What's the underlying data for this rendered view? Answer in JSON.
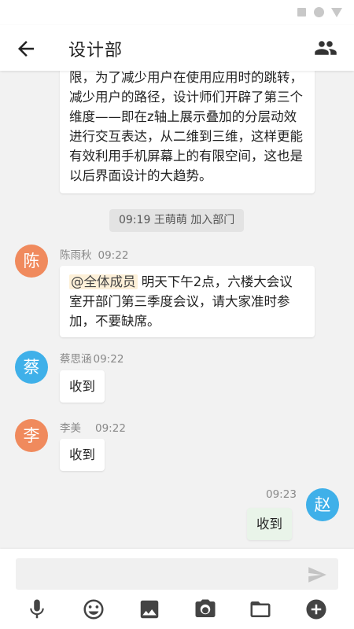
{
  "header": {
    "title": "设计部",
    "back_icon": "arrow-back-icon",
    "group_icon": "group-members-icon"
  },
  "messages": {
    "first": {
      "text": "限，为了减少用户在使用应用时的跳转，减少用户的路径，设计师们开辟了第三个维度——即在z轴上展示叠加的分层动效进行交互表达，从二维到三维，这样更能有效利用手机屏幕上的有限空间，这也是以后界面设计的大趋势。"
    },
    "system": {
      "text": "09:19 王萌萌 加入部门"
    },
    "chen": {
      "avatar": "陈",
      "avatar_color": "#f08a5d",
      "name": "陈雨秋",
      "time": "09:22",
      "mention": "@全体成员",
      "text": " 明天下午2点，六楼大会议室开部门第三季度会议，请大家准时参加，不要缺席。"
    },
    "cai": {
      "avatar": "蔡",
      "avatar_color": "#3fb0e9",
      "name": "蔡思涵",
      "time": "09:22",
      "text": "收到"
    },
    "li": {
      "avatar": "李",
      "avatar_color": "#f08a5d",
      "name": "李美",
      "time": "09:22",
      "text": "收到"
    },
    "me": {
      "avatar": "赵",
      "avatar_color": "#3fb0e9",
      "time": "09:23",
      "text": "收到"
    }
  },
  "input": {
    "placeholder": "",
    "send_icon": "send-icon"
  },
  "toolbar": {
    "icons": [
      "microphone-icon",
      "emoji-icon",
      "image-icon",
      "camera-icon",
      "folder-icon",
      "add-circle-icon"
    ]
  }
}
